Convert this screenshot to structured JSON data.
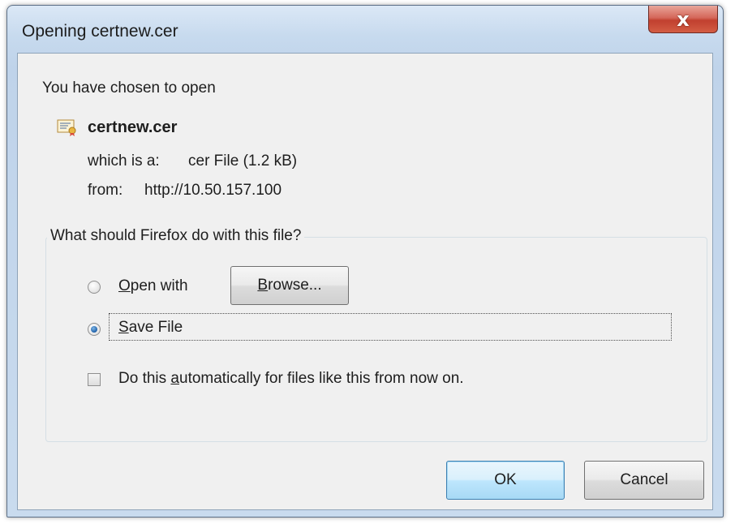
{
  "window": {
    "title": "Opening certnew.cer",
    "close_label": "x"
  },
  "intro_text": "You have chosen to open",
  "file": {
    "icon": "certificate-icon",
    "name": "certnew.cer",
    "type_label": "which is a:",
    "type_value": "cer File (1.2  kB)",
    "from_label": "from:",
    "from_value": "http://10.50.157.100"
  },
  "action_group": {
    "legend": "What should Firefox do with this file?",
    "open_with": {
      "accel": "O",
      "rest": "pen with",
      "selected": false
    },
    "browse": {
      "accel": "B",
      "rest": "rowse..."
    },
    "save_file": {
      "accel": "S",
      "rest": "ave File",
      "selected": true
    },
    "auto": {
      "pre": "Do this ",
      "accel": "a",
      "rest": "utomatically for files like this from now on.",
      "checked": false
    }
  },
  "buttons": {
    "ok": "OK",
    "cancel": "Cancel"
  },
  "colors": {
    "title_bar": "#c7daee",
    "client_bg": "#f0f0f0",
    "close_button": "#c1402f",
    "default_button_border": "#3c7fb1"
  }
}
